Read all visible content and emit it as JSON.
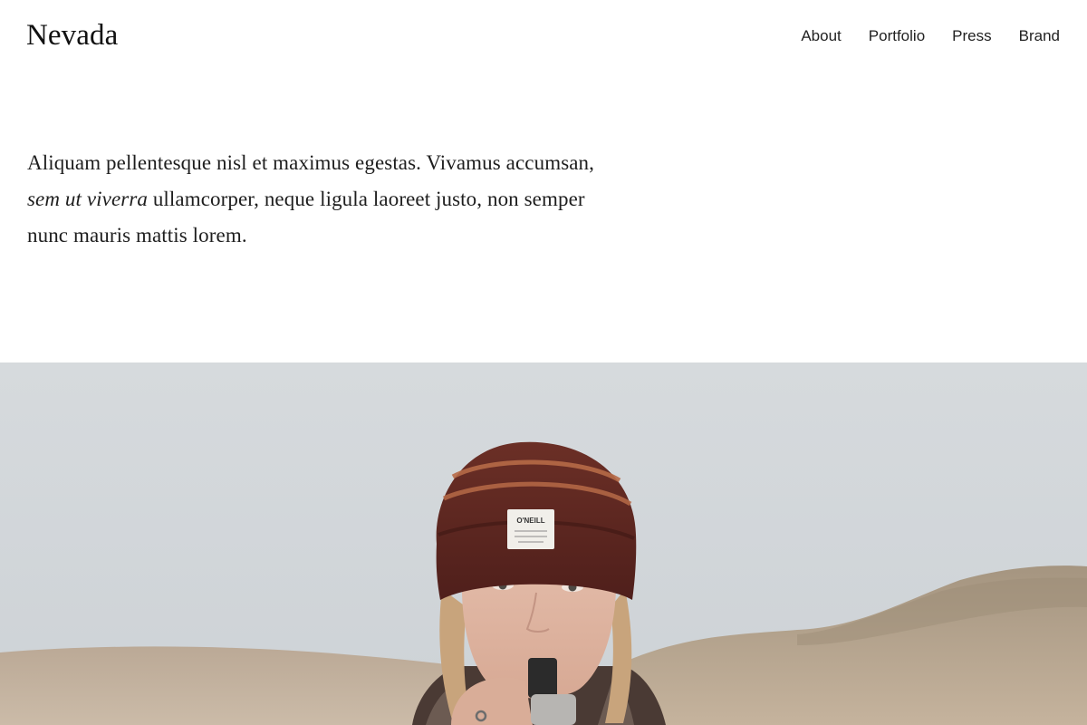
{
  "site": {
    "title": "Nevada"
  },
  "nav": {
    "items": [
      {
        "label": "About"
      },
      {
        "label": "Portfolio"
      },
      {
        "label": "Press"
      },
      {
        "label": "Brand"
      }
    ]
  },
  "intro": {
    "text_before": "Aliquam pellentesque nisl et maximus egestas. Vivamus accumsan, ",
    "text_italic": "sem ut viverra",
    "text_after": " ullamcorper, neque ligula laoreet justo, non semper nunc mauris mattis lorem."
  },
  "hero": {
    "beanie_label_line1": "O'NEILL",
    "colors": {
      "sky": "#d2d7db",
      "hill": "#b9a995",
      "beanie": "#5a2620",
      "beanie_stripe": "#b86b49",
      "skin": "#e0b8a4",
      "hair": "#c9a47b"
    }
  }
}
